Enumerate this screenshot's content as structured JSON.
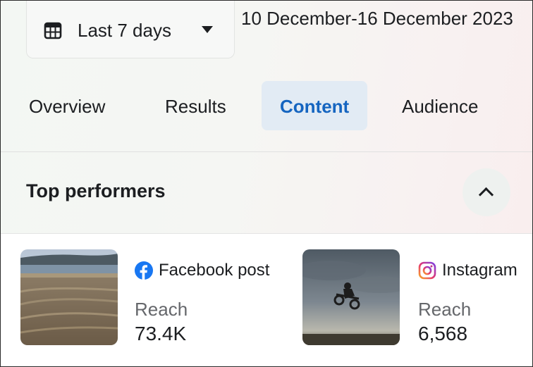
{
  "date_filter": {
    "label": "Last 7 days",
    "range": "10 December-16 December 2023"
  },
  "tabs": [
    {
      "label": "Overview",
      "active": false
    },
    {
      "label": "Results",
      "active": false
    },
    {
      "label": "Content",
      "active": true
    },
    {
      "label": "Audience",
      "active": false
    }
  ],
  "top_performers": {
    "title": "Top performers",
    "posts": [
      {
        "platform": "Facebook post",
        "platform_icon": "facebook-icon",
        "metric_label": "Reach",
        "metric_value": "73.4K"
      },
      {
        "platform": "Instagram",
        "platform_icon": "instagram-icon",
        "metric_label": "Reach",
        "metric_value": "6,568"
      }
    ]
  },
  "colors": {
    "accent": "#1565c0",
    "active_tab_bg": "#e2ebf4",
    "facebook_blue": "#1877f2",
    "muted_text": "#65676b"
  }
}
